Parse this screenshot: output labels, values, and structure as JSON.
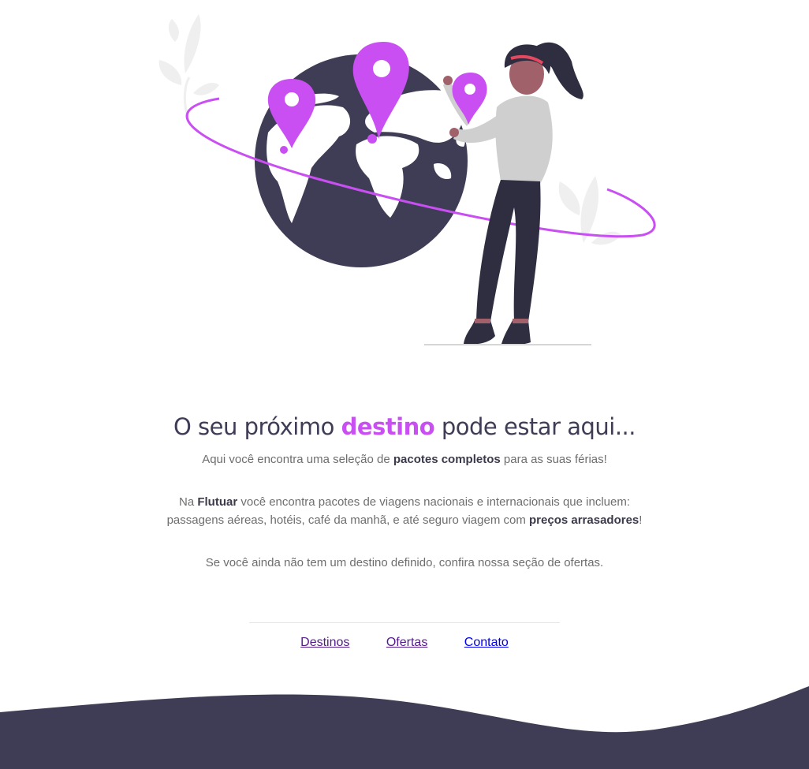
{
  "hero": {
    "illustration": "woman-placing-map-pins-on-globe",
    "colors": {
      "accent": "#c94ff2",
      "globe": "#3f3d56",
      "leaf": "#f0f0f0"
    }
  },
  "headline": {
    "prefix": "O seu próximo",
    "highlight": "destino",
    "suffix": "pode estar aqui..."
  },
  "intro": {
    "prefix": "Aqui você encontra uma seleção de",
    "bold": "pacotes completos",
    "suffix": "para as suas férias!"
  },
  "description": {
    "prefix": "Na",
    "brand": "Flutuar",
    "middle": "você encontra pacotes de viagens nacionais e internacionais que incluem:",
    "line2": "passagens aéreas, hotéis, café da manhã, e até seguro viagem com",
    "bold": "preços arrasadores",
    "end": "!"
  },
  "offers_note": "Se você ainda não tem um destino definido, confira nossa seção de ofertas.",
  "nav": {
    "items": [
      {
        "label": "Destinos",
        "state": "visited"
      },
      {
        "label": "Ofertas",
        "state": "visited"
      },
      {
        "label": "Contato",
        "state": "link"
      }
    ]
  },
  "footer": {
    "wave_color": "#3f3d56"
  }
}
